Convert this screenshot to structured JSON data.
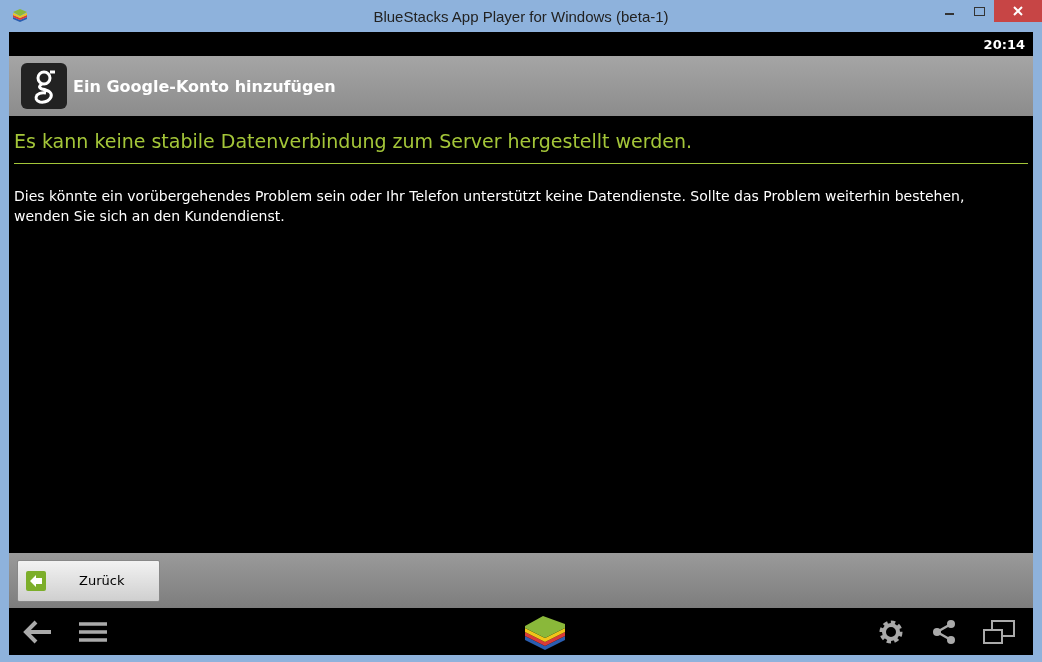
{
  "window": {
    "title": "BlueStacks App Player for Windows (beta-1)"
  },
  "status_bar": {
    "time": "20:14"
  },
  "action_bar": {
    "title": "Ein Google-Konto hinzufügen"
  },
  "content": {
    "heading": "Es kann keine stabile Datenverbindung zum Server hergestellt werden.",
    "message": "Dies könnte ein vorübergehendes Problem sein oder Ihr Telefon unterstützt keine Datendienste. Sollte das Problem weiterhin bestehen, wenden Sie sich an den Kundendienst."
  },
  "buttons": [
    {
      "label": "Zurück"
    }
  ]
}
